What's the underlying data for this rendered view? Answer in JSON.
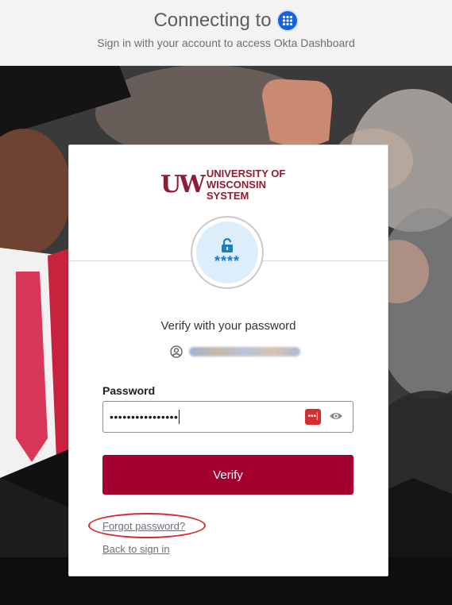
{
  "header": {
    "connecting_text": "Connecting to",
    "subtitle": "Sign in with your account to access Okta Dashboard",
    "app_icon": "okta-grid-icon"
  },
  "brand": {
    "logo_mark": "UW",
    "logo_line1": "UNIVERSITY OF",
    "logo_line2": "WISCONSIN SYSTEM",
    "color": "#8c1d34"
  },
  "factor": {
    "icon": "password-lock-icon",
    "stars": "****"
  },
  "form": {
    "heading": "Verify with your password",
    "identifier_icon": "user-icon",
    "password_label": "Password",
    "password_value": "••••••••••••••••",
    "password_manager_icon": "password-manager-icon",
    "toggle_icon": "eye-icon",
    "submit_label": "Verify",
    "submit_color": "#a3002f"
  },
  "links": {
    "forgot": "Forgot password?",
    "back": "Back to sign in"
  }
}
